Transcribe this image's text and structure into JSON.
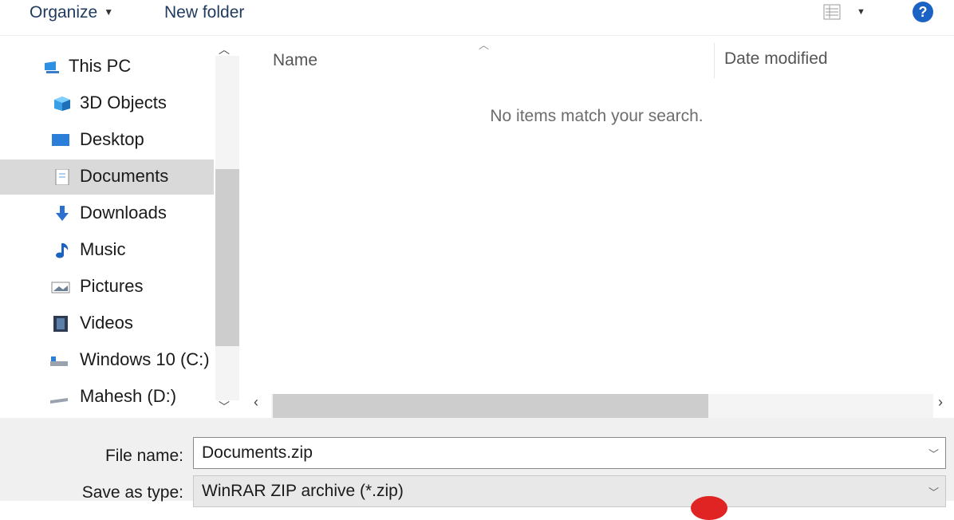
{
  "toolbar": {
    "organize_label": "Organize",
    "new_folder_label": "New folder",
    "help_glyph": "?"
  },
  "navigation": {
    "items": [
      {
        "label": "This PC",
        "icon": "computer-icon",
        "selected": false
      },
      {
        "label": "3D Objects",
        "icon": "cube-icon",
        "selected": false
      },
      {
        "label": "Desktop",
        "icon": "desktop-icon",
        "selected": false
      },
      {
        "label": "Documents",
        "icon": "document-icon",
        "selected": true
      },
      {
        "label": "Downloads",
        "icon": "download-arrow-icon",
        "selected": false
      },
      {
        "label": "Music",
        "icon": "music-note-icon",
        "selected": false
      },
      {
        "label": "Pictures",
        "icon": "picture-icon",
        "selected": false
      },
      {
        "label": "Videos",
        "icon": "film-icon",
        "selected": false
      },
      {
        "label": "Windows 10 (C:)",
        "icon": "drive-icon",
        "selected": false
      },
      {
        "label": "Mahesh (D:)",
        "icon": "drive-icon",
        "selected": false
      }
    ]
  },
  "content": {
    "columns": [
      "Name",
      "Date modified"
    ],
    "empty_message": "No items match your search."
  },
  "footer": {
    "file_name_label": "File name:",
    "file_name_value": "Documents.zip",
    "save_type_label": "Save as type:",
    "save_type_value": "WinRAR ZIP archive (*.zip)"
  },
  "colors": {
    "accent": "#1a63c4",
    "selection": "#d9d9d9",
    "footer_bg": "#f0f0f0"
  }
}
